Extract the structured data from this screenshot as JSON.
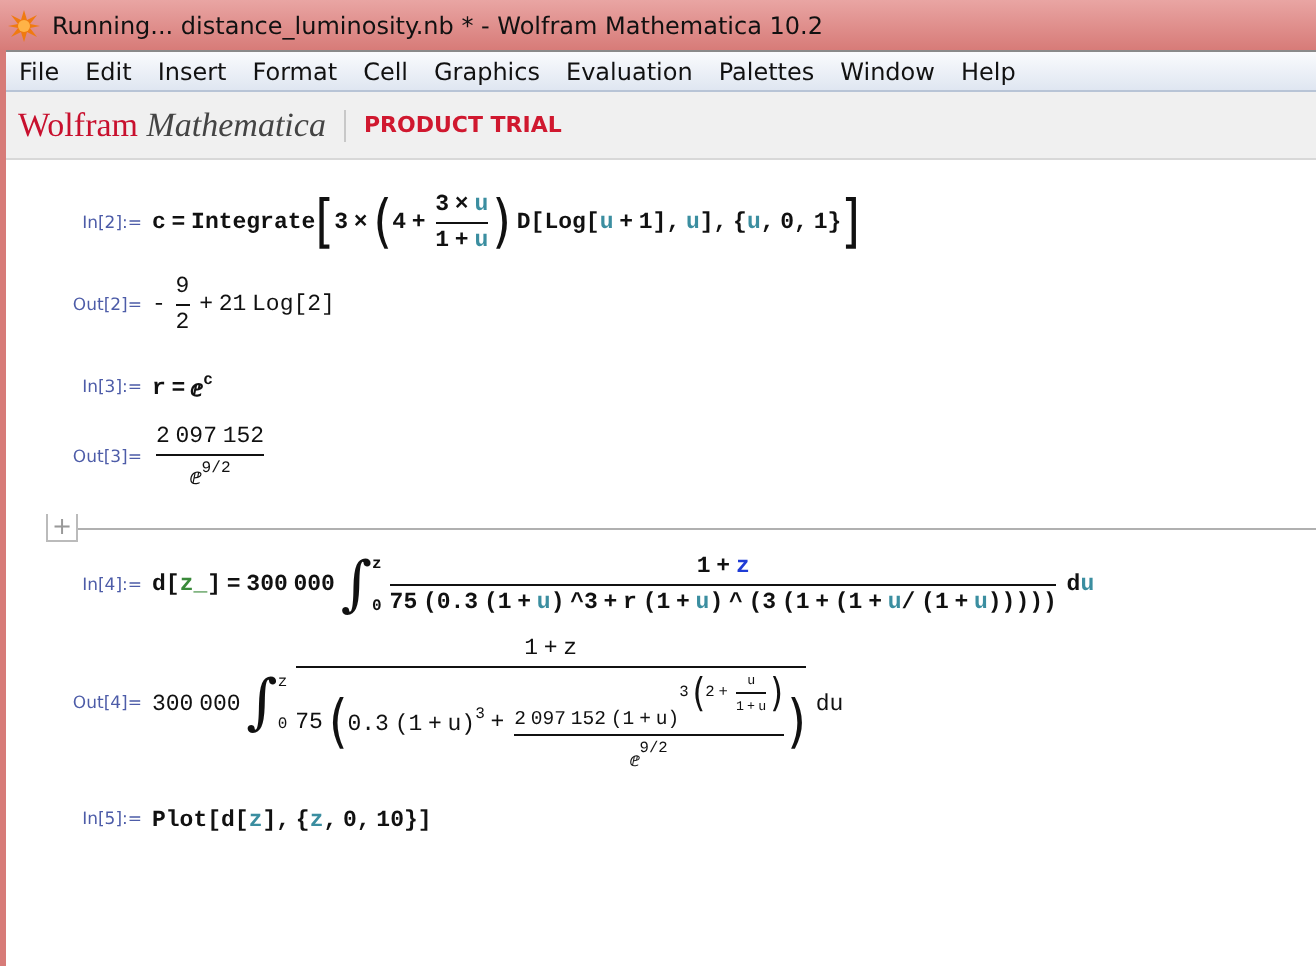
{
  "window": {
    "title": "Running... distance_luminosity.nb * - Wolfram Mathematica 10.2"
  },
  "menu": [
    "File",
    "Edit",
    "Insert",
    "Format",
    "Cell",
    "Graphics",
    "Evaluation",
    "Palettes",
    "Window",
    "Help"
  ],
  "toolbar": {
    "brand": "Wolfram",
    "product": "Mathematica",
    "badge": "PRODUCT TRIAL"
  },
  "cells": [
    {
      "kind": "input",
      "label": "In[2]:=",
      "expr": [
        {
          "kind": "t",
          "text": "c = Integrate"
        },
        {
          "kind": "group",
          "open": "[",
          "close": "]",
          "body": [
            {
              "kind": "t",
              "text": "3 × "
            },
            {
              "kind": "group",
              "open": "(",
              "close": ")",
              "body": [
                {
                  "kind": "t",
                  "text": "4 + "
                },
                {
                  "kind": "frac",
                  "num": [
                    {
                      "kind": "t",
                      "text": "3 × "
                    },
                    {
                      "kind": "local",
                      "text": "u"
                    }
                  ],
                  "den": [
                    {
                      "kind": "t",
                      "text": "1 + "
                    },
                    {
                      "kind": "local",
                      "text": "u"
                    }
                  ]
                }
              ]
            },
            {
              "kind": "t",
              "text": " D[Log["
            },
            {
              "kind": "local",
              "text": "u"
            },
            {
              "kind": "t",
              "text": " + 1], "
            },
            {
              "kind": "local",
              "text": "u"
            },
            {
              "kind": "t",
              "text": "], {"
            },
            {
              "kind": "local",
              "text": "u"
            },
            {
              "kind": "t",
              "text": ", 0, 1}"
            }
          ]
        }
      ]
    },
    {
      "kind": "output",
      "label": "Out[2]=",
      "expr": [
        {
          "kind": "t",
          "text": "- "
        },
        {
          "kind": "frac",
          "num": [
            {
              "kind": "t",
              "text": "9"
            }
          ],
          "den": [
            {
              "kind": "t",
              "text": "2"
            }
          ]
        },
        {
          "kind": "t",
          "text": " + 21 Log[2]"
        }
      ]
    },
    {
      "kind": "input",
      "label": "In[3]:=",
      "expr": [
        {
          "kind": "t",
          "text": "r = "
        },
        {
          "kind": "sup",
          "base": [
            {
              "kind": "t",
              "text": "ⅇ"
            }
          ],
          "exp": [
            {
              "kind": "t",
              "text": "c"
            }
          ]
        }
      ]
    },
    {
      "kind": "output",
      "label": "Out[3]=",
      "expr": [
        {
          "kind": "frac",
          "num": [
            {
              "kind": "t",
              "text": "2 097 152"
            }
          ],
          "den": [
            {
              "kind": "sup",
              "base": [
                {
                  "kind": "t",
                  "text": "ⅇ"
                }
              ],
              "exp": [
                {
                  "kind": "t",
                  "text": "9/2"
                }
              ]
            }
          ]
        }
      ]
    },
    {
      "kind": "divider",
      "label": "+"
    },
    {
      "kind": "input",
      "label": "In[4]:=",
      "expr": [
        {
          "kind": "t",
          "text": "d["
        },
        {
          "kind": "pattern",
          "text": "z_"
        },
        {
          "kind": "t",
          "text": "] = 300 000 "
        },
        {
          "kind": "int",
          "sign": "∫",
          "lower": "0",
          "upper": "z"
        },
        {
          "kind": "frac",
          "num": [
            {
              "kind": "t",
              "text": "1 + "
            },
            {
              "kind": "global",
              "text": "z"
            }
          ],
          "den": [
            {
              "kind": "t",
              "text": "75 (0.3 (1 + "
            },
            {
              "kind": "local",
              "text": "u"
            },
            {
              "kind": "t",
              "text": ") ^3 + r (1 + "
            },
            {
              "kind": "local",
              "text": "u"
            },
            {
              "kind": "t",
              "text": ") ^ (3 (1 + (1 + "
            },
            {
              "kind": "local",
              "text": "u"
            },
            {
              "kind": "t",
              "text": "/ (1 + "
            },
            {
              "kind": "local",
              "text": "u"
            },
            {
              "kind": "t",
              "text": ")))))"
            }
          ]
        },
        {
          "kind": "t",
          "text": " d"
        },
        {
          "kind": "local",
          "text": "u"
        }
      ]
    },
    {
      "kind": "output",
      "label": "Out[4]=",
      "expr": [
        {
          "kind": "t",
          "text": "300 000 "
        },
        {
          "kind": "int",
          "sign": "∫",
          "lower": "0",
          "upper": "z"
        },
        {
          "kind": "frac",
          "num": [
            {
              "kind": "t",
              "text": "1 + z"
            }
          ],
          "den": [
            {
              "kind": "t",
              "text": "75 "
            },
            {
              "kind": "group",
              "open": "(",
              "close": ")",
              "body": [
                {
                  "kind": "sup",
                  "base": [
                    {
                      "kind": "t",
                      "text": "0.3 (1 + u)"
                    }
                  ],
                  "exp": [
                    {
                      "kind": "t",
                      "text": "3"
                    }
                  ]
                },
                {
                  "kind": "t",
                  "text": " + "
                },
                {
                  "kind": "frac",
                  "num": [
                    {
                      "kind": "sup",
                      "base": [
                        {
                          "kind": "t",
                          "text": "2 097 152 (1 + u)"
                        }
                      ],
                      "exp": [
                        {
                          "kind": "t",
                          "text": "3 "
                        },
                        {
                          "kind": "group",
                          "open": "(",
                          "close": ")",
                          "body": [
                            {
                              "kind": "t",
                              "text": "2 + "
                            },
                            {
                              "kind": "frac",
                              "num": [
                                {
                                  "kind": "t",
                                  "text": "u"
                                }
                              ],
                              "den": [
                                {
                                  "kind": "t",
                                  "text": "1 + u"
                                }
                              ]
                            }
                          ]
                        }
                      ]
                    }
                  ],
                  "den": [
                    {
                      "kind": "sup",
                      "base": [
                        {
                          "kind": "t",
                          "text": "ⅇ"
                        }
                      ],
                      "exp": [
                        {
                          "kind": "t",
                          "text": "9/2"
                        }
                      ]
                    }
                  ]
                }
              ]
            }
          ]
        },
        {
          "kind": "t",
          "text": " du"
        }
      ]
    },
    {
      "kind": "input",
      "label": "In[5]:=",
      "expr": [
        {
          "kind": "t",
          "text": "Plot[d["
        },
        {
          "kind": "local",
          "text": "z"
        },
        {
          "kind": "t",
          "text": "], {"
        },
        {
          "kind": "local",
          "text": "z"
        },
        {
          "kind": "t",
          "text": ", 0, 10}]"
        }
      ]
    }
  ]
}
